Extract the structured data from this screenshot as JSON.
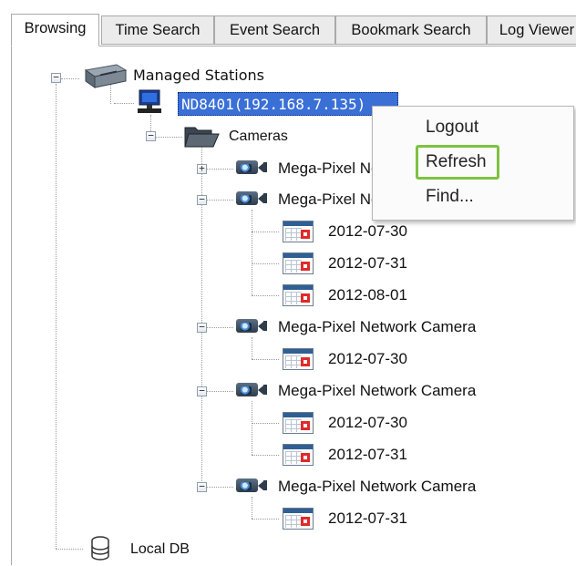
{
  "tabs": [
    {
      "label": "Browsing",
      "active": true
    },
    {
      "label": "Time Search",
      "active": false
    },
    {
      "label": "Event Search",
      "active": false
    },
    {
      "label": "Bookmark Search",
      "active": false
    },
    {
      "label": "Log Viewer",
      "active": false
    }
  ],
  "tree": {
    "root": {
      "label": "Managed Stations",
      "icon": "server-icon"
    },
    "station": {
      "label": "ND8401(192.168.7.135)",
      "icon": "monitor-icon",
      "selected": true
    },
    "cameras_folder": {
      "label": "Cameras",
      "icon": "folder-open-icon"
    },
    "cameras": [
      {
        "label": "Mega-Pixel Network Camera",
        "expanded": false,
        "dates": []
      },
      {
        "label": "Mega-Pixel Network Camera",
        "expanded": true,
        "dates": [
          "2012-07-30",
          "2012-07-31",
          "2012-08-01"
        ]
      },
      {
        "label": "Mega-Pixel Network Camera",
        "expanded": true,
        "dates": [
          "2012-07-30"
        ]
      },
      {
        "label": "Mega-Pixel Network Camera",
        "expanded": true,
        "dates": [
          "2012-07-30",
          "2012-07-31"
        ]
      },
      {
        "label": "Mega-Pixel Network Camera",
        "expanded": true,
        "dates": [
          "2012-07-31"
        ]
      }
    ],
    "local_db": {
      "label": "Local DB",
      "icon": "database-icon"
    }
  },
  "context_menu": {
    "items": [
      "Logout",
      "Refresh",
      "Find..."
    ],
    "highlighted": "Refresh",
    "highlight_color": "#7dc241"
  },
  "colors": {
    "selection": "#3a6fd6"
  }
}
